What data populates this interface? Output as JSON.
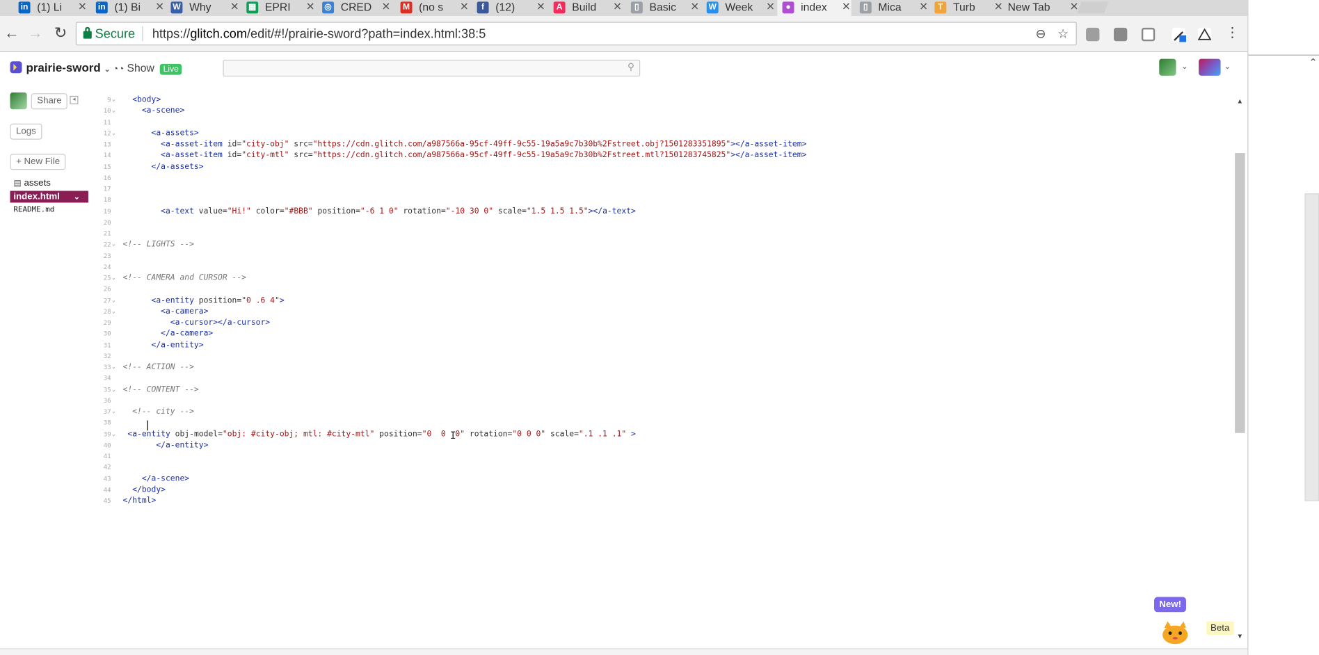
{
  "browser": {
    "tabs": [
      {
        "title": "(1) Li",
        "favicon": "linkedin-icon",
        "color": "#0a66c2",
        "glyph": "in"
      },
      {
        "title": "(1) Bi",
        "favicon": "linkedin-icon",
        "color": "#0a66c2",
        "glyph": "in"
      },
      {
        "title": "Why",
        "favicon": "wire-icon",
        "color": "#3a5ea8",
        "glyph": "W"
      },
      {
        "title": "EPRI",
        "favicon": "sheets-icon",
        "color": "#0f9d58",
        "glyph": "▦"
      },
      {
        "title": "CRED",
        "favicon": "chrome-icon",
        "color": "#3b82d6",
        "glyph": "◎"
      },
      {
        "title": "(no s",
        "favicon": "gmail-icon",
        "color": "#d93025",
        "glyph": "M"
      },
      {
        "title": "(12)",
        "favicon": "facebook-icon",
        "color": "#3b5998",
        "glyph": "f"
      },
      {
        "title": "Build",
        "favicon": "aframe-icon",
        "color": "#ef2d5e",
        "glyph": "A"
      },
      {
        "title": "Basic",
        "favicon": "page-icon",
        "color": "#9aa0a6",
        "glyph": "▯"
      },
      {
        "title": "Week",
        "favicon": "weebly-icon",
        "color": "#2990ea",
        "glyph": "W"
      },
      {
        "title": "index",
        "favicon": "glitch-icon",
        "color": "#b04fd1",
        "glyph": "●"
      },
      {
        "title": "Mica",
        "favicon": "page-icon",
        "color": "#9aa0a6",
        "glyph": "▯"
      },
      {
        "title": "Turb",
        "favicon": "turbo-icon",
        "color": "#f2a33a",
        "glyph": "T"
      },
      {
        "title": "New Tab",
        "favicon": "",
        "color": "",
        "glyph": ""
      }
    ],
    "close_glyph": "✕",
    "secure_label": "Secure",
    "url_prefix": "https://",
    "url_host": "glitch.com",
    "url_path": "/edit/#!/prairie-sword?path=index.html:38:5"
  },
  "glitch": {
    "project_name": "prairie-sword",
    "show_label": "Show",
    "live_label": "Live",
    "search_placeholder": "",
    "share_label": "Share",
    "logs_label": "Logs",
    "new_file_label": "+ New File",
    "files": [
      "assets",
      "index.html",
      "README.md"
    ],
    "new_badge": "New!",
    "beta_badge": "Beta"
  },
  "editor": {
    "lines": [
      {
        "n": "9",
        "fold": true,
        "html": "  <span class='tag'>&lt;body&gt;</span>"
      },
      {
        "n": "10",
        "fold": true,
        "html": "    <span class='tag'>&lt;a-scene&gt;</span>"
      },
      {
        "n": "11",
        "fold": false,
        "html": ""
      },
      {
        "n": "12",
        "fold": true,
        "html": "      <span class='tag'>&lt;a-assets&gt;</span>"
      },
      {
        "n": "13",
        "fold": false,
        "html": "        <span class='tag'>&lt;a-asset-item</span> <span class='attr'>id=</span><span class='str'>\"city-obj\"</span> <span class='attr'>src=</span><span class='str'>\"https://cdn.glitch.com/a987566a-95cf-49ff-9c55-19a5a9c7b30b%2Fstreet.obj?1501283351895\"</span><span class='tag'>&gt;&lt;/a-asset-item&gt;</span>"
      },
      {
        "n": "14",
        "fold": false,
        "html": "        <span class='tag'>&lt;a-asset-item</span> <span class='attr'>id=</span><span class='str'>\"city-mtl\"</span> <span class='attr'>src=</span><span class='str'>\"https://cdn.glitch.com/a987566a-95cf-49ff-9c55-19a5a9c7b30b%2Fstreet.mtl?1501283745825\"</span><span class='tag'>&gt;&lt;/a-asset-item&gt;</span>"
      },
      {
        "n": "15",
        "fold": false,
        "html": "      <span class='tag'>&lt;/a-assets&gt;</span>"
      },
      {
        "n": "16",
        "fold": false,
        "html": ""
      },
      {
        "n": "17",
        "fold": false,
        "html": ""
      },
      {
        "n": "18",
        "fold": false,
        "html": ""
      },
      {
        "n": "19",
        "fold": false,
        "html": "        <span class='tag'>&lt;a-text</span> <span class='attr'>value=</span><span class='str'>\"Hi!\"</span> <span class='attr'>color=</span><span class='str'>\"#BBB\"</span> <span class='attr'>position=</span><span class='str'>\"-6 1 0\"</span> <span class='attr'>rotation=</span><span class='str'>\"-10 30 0\"</span> <span class='attr'>scale=</span><span class='str'>\"1.5 1.5 1.5\"</span><span class='tag'>&gt;&lt;/a-text&gt;</span>"
      },
      {
        "n": "20",
        "fold": false,
        "html": ""
      },
      {
        "n": "21",
        "fold": false,
        "html": ""
      },
      {
        "n": "22",
        "fold": true,
        "html": "<span class='cmt'>&lt;!-- LIGHTS --&gt;</span>"
      },
      {
        "n": "23",
        "fold": false,
        "html": ""
      },
      {
        "n": "24",
        "fold": false,
        "html": ""
      },
      {
        "n": "25",
        "fold": true,
        "html": "<span class='cmt'>&lt;!-- CAMERA and CURSOR --&gt;</span>"
      },
      {
        "n": "26",
        "fold": false,
        "html": ""
      },
      {
        "n": "27",
        "fold": true,
        "html": "      <span class='tag'>&lt;a-entity</span> <span class='attr'>position=</span><span class='str'>\"0 .6 4\"</span><span class='tag'>&gt;</span>"
      },
      {
        "n": "28",
        "fold": true,
        "html": "        <span class='tag'>&lt;a-camera&gt;</span>"
      },
      {
        "n": "29",
        "fold": false,
        "html": "          <span class='tag'>&lt;a-cursor&gt;&lt;/a-cursor&gt;</span>"
      },
      {
        "n": "30",
        "fold": false,
        "html": "        <span class='tag'>&lt;/a-camera&gt;</span>"
      },
      {
        "n": "31",
        "fold": false,
        "html": "      <span class='tag'>&lt;/a-entity&gt;</span>"
      },
      {
        "n": "32",
        "fold": false,
        "html": ""
      },
      {
        "n": "33",
        "fold": true,
        "html": "<span class='cmt'>&lt;!-- ACTION --&gt;</span>"
      },
      {
        "n": "34",
        "fold": false,
        "html": ""
      },
      {
        "n": "35",
        "fold": true,
        "html": "<span class='cmt'>&lt;!-- CONTENT --&gt;</span>"
      },
      {
        "n": "36",
        "fold": false,
        "html": ""
      },
      {
        "n": "37",
        "fold": true,
        "html": "  <span class='cmt'>&lt;!-- city --&gt;</span>"
      },
      {
        "n": "38",
        "fold": false,
        "html": ""
      },
      {
        "n": "39",
        "fold": true,
        "html": " <span class='tag'>&lt;a-entity</span> <span class='attr'>obj-model=</span><span class='str'>\"obj: #city-obj; mtl: #city-mtl\"</span> <span class='attr'>position=</span><span class='str'>\"0  0  0\"</span> <span class='attr'>rotation=</span><span class='str'>\"0 0 0\"</span> <span class='attr'>scale=</span><span class='str'>\".1 .1 .1\"</span> <span class='tag'>&gt;</span>"
      },
      {
        "n": "40",
        "fold": false,
        "html": "       <span class='tag'>&lt;/a-entity&gt;</span>"
      },
      {
        "n": "41",
        "fold": false,
        "html": ""
      },
      {
        "n": "42",
        "fold": false,
        "html": ""
      },
      {
        "n": "43",
        "fold": false,
        "html": "    <span class='tag'>&lt;/a-scene&gt;</span>"
      },
      {
        "n": "44",
        "fold": false,
        "html": "  <span class='tag'>&lt;/body&gt;</span>"
      },
      {
        "n": "45",
        "fold": false,
        "html": "<span class='tag'>&lt;/html&gt;</span>"
      }
    ]
  },
  "colors": {
    "secure": "#0b8043",
    "active_file_bg": "#8b1d55",
    "live_badge": "#3ec366",
    "new_badge": "#7b68ee"
  }
}
